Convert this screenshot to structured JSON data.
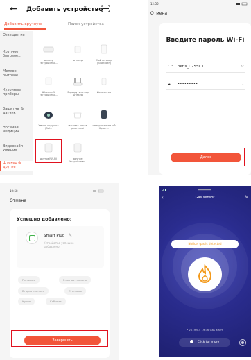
{
  "add_device": {
    "back": "←",
    "title": "Добавить устройство",
    "tab_manual": "Добавить вручную",
    "tab_search": "Поиск устройства",
    "categories": [
      {
        "label": "Освещен ие"
      },
      {
        "label": "Крупное бытовое..."
      },
      {
        "label": "Мелкое бытовое..."
      },
      {
        "label": "Кухонные приборы"
      },
      {
        "label": "Защитны & датчик"
      },
      {
        "label": "Носимая медицин..."
      },
      {
        "label": "Видеонабл юдение"
      },
      {
        "label": "Штекер & другие"
      }
    ],
    "devices": [
      {
        "label": "штекер (Устройство..."
      },
      {
        "label": "штекер"
      },
      {
        "label": "Мой штекер (Bluetooth)"
      },
      {
        "label": "Штекер 1 (Устройство..."
      },
      {
        "label": "Маршрутизат ор штекер"
      },
      {
        "label": "Ионизатор"
      },
      {
        "label": "Умная игрушка (Bcl..."
      },
      {
        "label": "машина роста растений"
      },
      {
        "label": "интерактивна ый Кулит..."
      },
      {
        "label": "другое(Wi-Fi)"
      },
      {
        "label": "другое (Устройство..."
      }
    ]
  },
  "wifi": {
    "status_time": "12:56",
    "cancel": "Отмена",
    "title": "Введите пароль Wi-Fi",
    "network": "netis_C255C1",
    "password": "•••••••••",
    "change": "Ac",
    "next": "Далее"
  },
  "added": {
    "status_time": "10:58",
    "cancel": "Отмена",
    "title": "Успешно добавлено:",
    "device_name": "Smart Plug",
    "device_desc": "Устройство успешно добавлено",
    "rooms": [
      "Гостиная",
      "Главная спальня",
      "Вторая спальня",
      "Столовая",
      "Кухня",
      "Кабинет"
    ],
    "done": "Завершить"
  },
  "gas": {
    "title": "Gas sensor",
    "notice": "Notice, gas is detected",
    "alarm": "• 2019.6.5 19:36 Gas alarm",
    "more": "Click for more"
  }
}
